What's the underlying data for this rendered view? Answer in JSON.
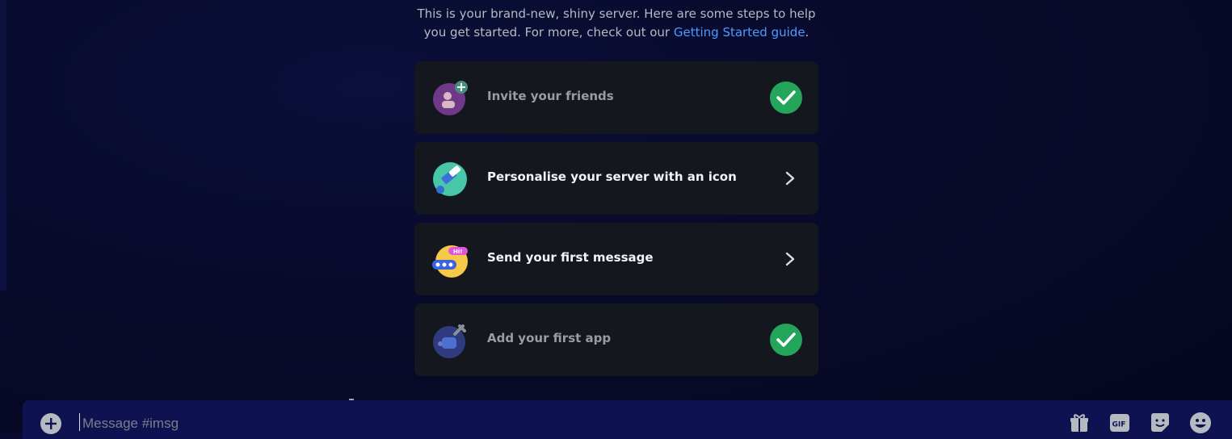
{
  "intro": {
    "text": "This is your brand-new, shiny server. Here are some steps to help you get started. For more, check out our ",
    "link": "Getting Started guide",
    "period": "."
  },
  "steps": [
    {
      "label": "Invite your friends",
      "status": "completed",
      "icon": "invite-friends-icon"
    },
    {
      "label": "Personalise your server with an icon",
      "status": "pending",
      "icon": "paintbrush-icon"
    },
    {
      "label": "Send your first message",
      "status": "pending",
      "icon": "chat-bubble-icon"
    },
    {
      "label": "Add your first app",
      "status": "completed",
      "icon": "wrench-icon"
    }
  ],
  "composer": {
    "placeholder": "Message #imsg"
  },
  "colors": {
    "accent_link": "#4d9bff",
    "success": "#23a55a",
    "card_bg": "#15171e"
  }
}
